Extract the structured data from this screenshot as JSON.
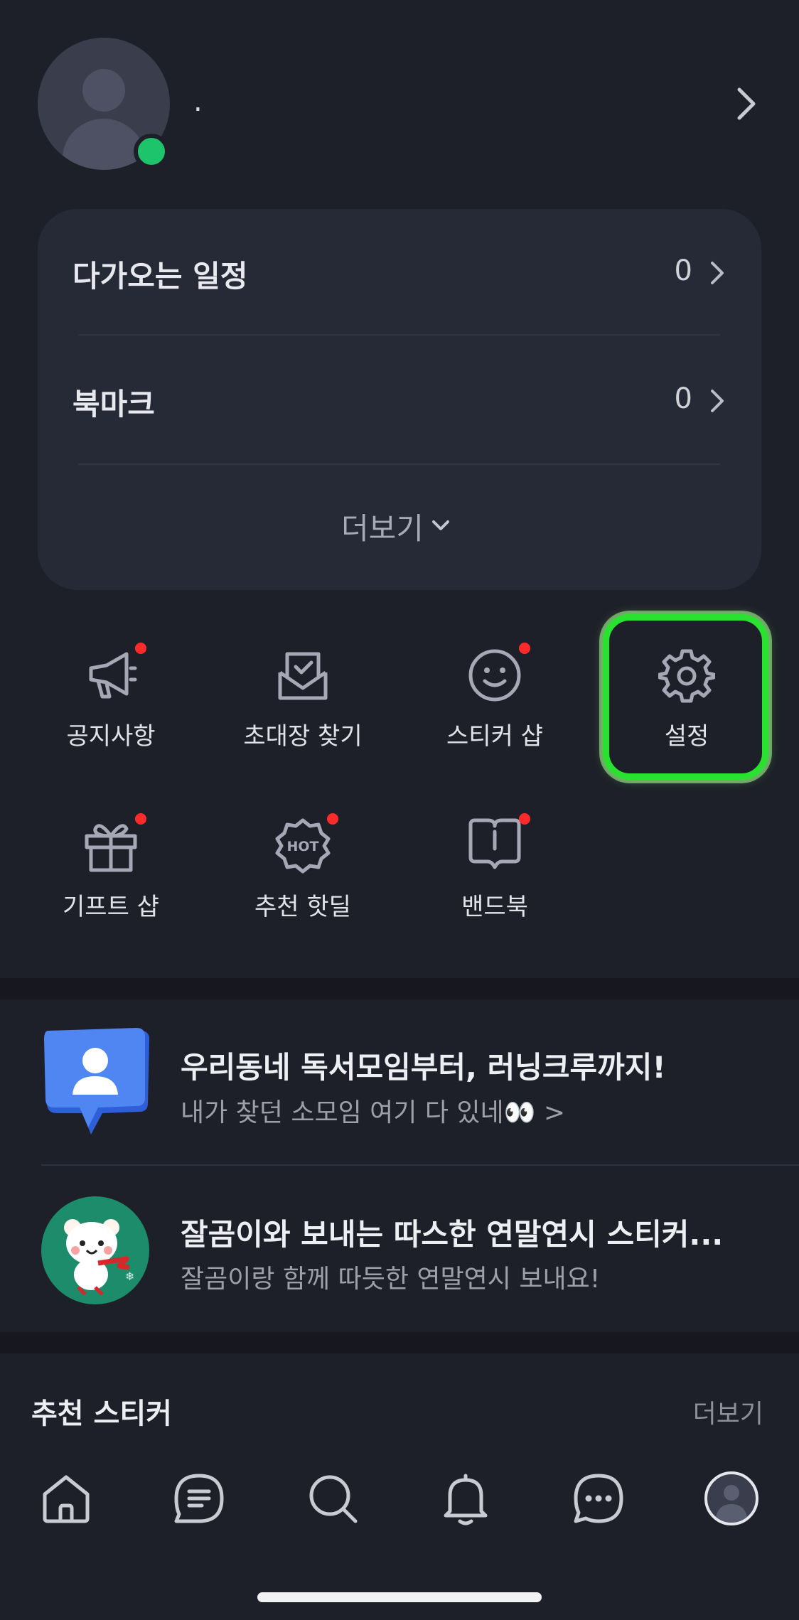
{
  "profile": {
    "name": "."
  },
  "summary": {
    "rows": [
      {
        "label": "다가오는 일정",
        "count": "0"
      },
      {
        "label": "북마크",
        "count": "0"
      }
    ],
    "more_label": "더보기"
  },
  "menu": {
    "items": [
      {
        "label": "공지사항",
        "icon": "megaphone-icon",
        "badge": true
      },
      {
        "label": "초대장 찾기",
        "icon": "envelope-icon",
        "badge": false
      },
      {
        "label": "스티커 샵",
        "icon": "smiley-icon",
        "badge": true
      },
      {
        "label": "설정",
        "icon": "gear-icon",
        "badge": false
      },
      {
        "label": "기프트 샵",
        "icon": "gift-icon",
        "badge": true
      },
      {
        "label": "추천 핫딜",
        "icon": "hot-badge-icon",
        "badge": true
      },
      {
        "label": "밴드북",
        "icon": "book-icon",
        "badge": true
      }
    ],
    "hot_text": "HOT"
  },
  "banners": [
    {
      "title": "우리동네 독서모임부터, 러닝크루까지!",
      "subtitle": "내가 찾던 소모임 여기 다 있네👀 >",
      "icon": "community-icon"
    },
    {
      "title": "잘곰이와 보내는 따스한 연말연시 스티커...",
      "subtitle": "잘곰이랑 함께 따듯한 연말연시 보내요!",
      "icon": "bear-sticker-icon"
    }
  ],
  "recommend": {
    "title": "추천 스티커",
    "more_label": "더보기"
  },
  "bottom_nav": [
    {
      "name": "home",
      "icon": "home-icon"
    },
    {
      "name": "feed",
      "icon": "feed-icon"
    },
    {
      "name": "search",
      "icon": "search-icon"
    },
    {
      "name": "notifications",
      "icon": "bell-icon"
    },
    {
      "name": "chats",
      "icon": "chat-icon"
    },
    {
      "name": "profile",
      "icon": "profile-icon"
    }
  ],
  "colors": {
    "background": "#1e2029",
    "card": "#262936",
    "online": "#1ec46b",
    "badge": "#ff2b2b",
    "highlight": "#29e12f"
  }
}
